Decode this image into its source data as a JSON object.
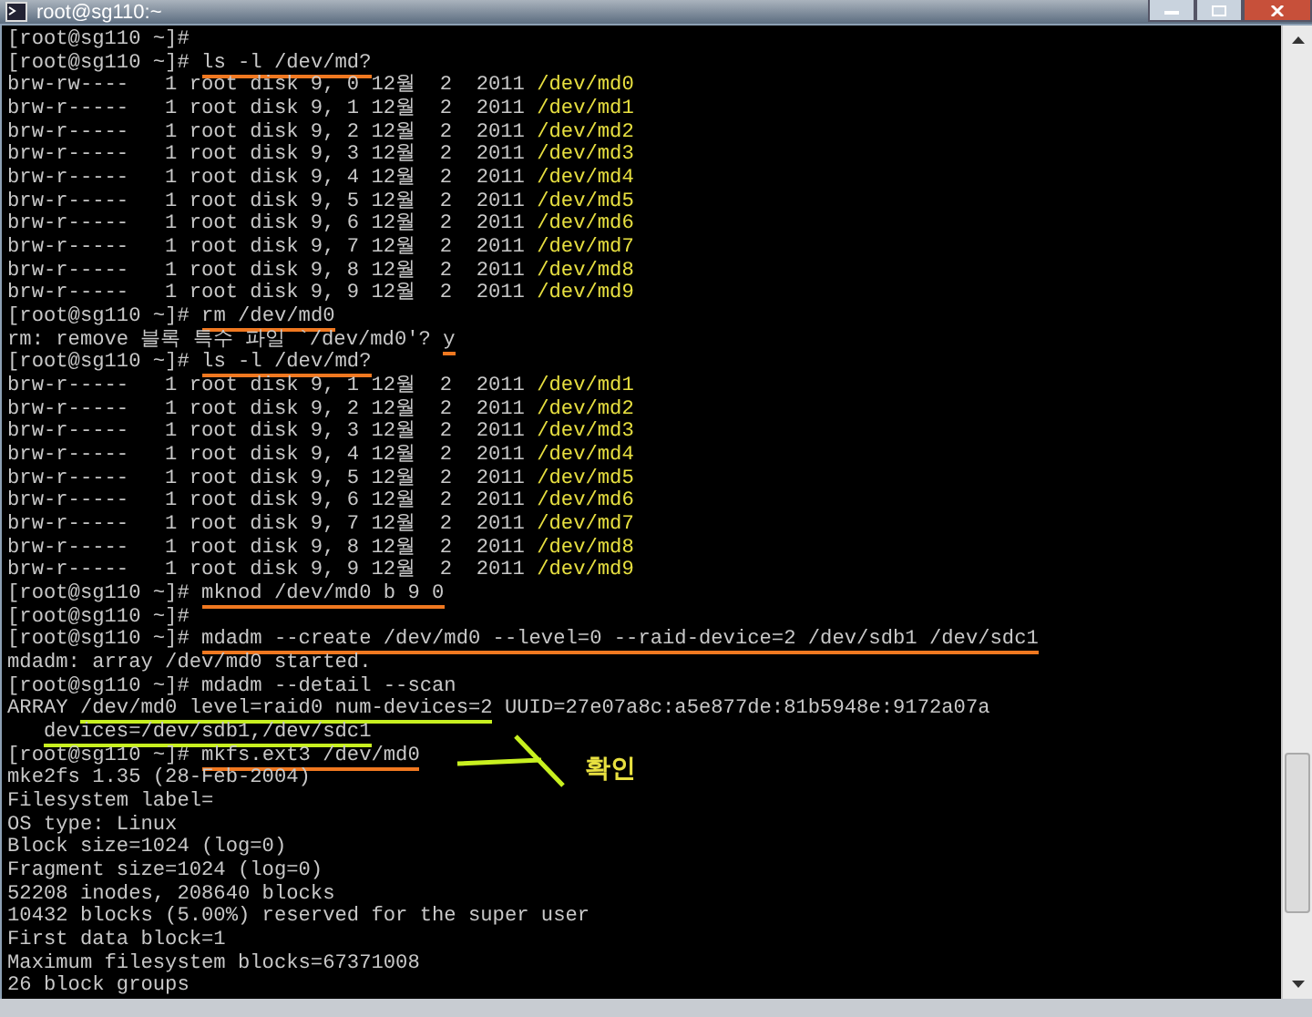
{
  "window": {
    "title": "root@sg110:~"
  },
  "terminal": {
    "lines": [
      {
        "segments": [
          {
            "text": "[root@sg110 ~]#",
            "kind": "text"
          }
        ]
      },
      {
        "segments": [
          {
            "text": "[root@sg110 ~]# ",
            "kind": "text"
          },
          {
            "text": "ls -l /dev/md?",
            "kind": "command"
          }
        ]
      },
      {
        "segments": [
          {
            "text": "brw-rw----   1 root disk 9, 0 12월  2  2011 ",
            "kind": "text"
          },
          {
            "text": "/dev/md0",
            "kind": "path"
          }
        ]
      },
      {
        "segments": [
          {
            "text": "brw-r-----   1 root disk 9, 1 12월  2  2011 ",
            "kind": "text"
          },
          {
            "text": "/dev/md1",
            "kind": "path"
          }
        ]
      },
      {
        "segments": [
          {
            "text": "brw-r-----   1 root disk 9, 2 12월  2  2011 ",
            "kind": "text"
          },
          {
            "text": "/dev/md2",
            "kind": "path"
          }
        ]
      },
      {
        "segments": [
          {
            "text": "brw-r-----   1 root disk 9, 3 12월  2  2011 ",
            "kind": "text"
          },
          {
            "text": "/dev/md3",
            "kind": "path"
          }
        ]
      },
      {
        "segments": [
          {
            "text": "brw-r-----   1 root disk 9, 4 12월  2  2011 ",
            "kind": "text"
          },
          {
            "text": "/dev/md4",
            "kind": "path"
          }
        ]
      },
      {
        "segments": [
          {
            "text": "brw-r-----   1 root disk 9, 5 12월  2  2011 ",
            "kind": "text"
          },
          {
            "text": "/dev/md5",
            "kind": "path"
          }
        ]
      },
      {
        "segments": [
          {
            "text": "brw-r-----   1 root disk 9, 6 12월  2  2011 ",
            "kind": "text"
          },
          {
            "text": "/dev/md6",
            "kind": "path"
          }
        ]
      },
      {
        "segments": [
          {
            "text": "brw-r-----   1 root disk 9, 7 12월  2  2011 ",
            "kind": "text"
          },
          {
            "text": "/dev/md7",
            "kind": "path"
          }
        ]
      },
      {
        "segments": [
          {
            "text": "brw-r-----   1 root disk 9, 8 12월  2  2011 ",
            "kind": "text"
          },
          {
            "text": "/dev/md8",
            "kind": "path"
          }
        ]
      },
      {
        "segments": [
          {
            "text": "brw-r-----   1 root disk 9, 9 12월  2  2011 ",
            "kind": "text"
          },
          {
            "text": "/dev/md9",
            "kind": "path"
          }
        ]
      },
      {
        "segments": [
          {
            "text": "[root@sg110 ~]# ",
            "kind": "text"
          },
          {
            "text": "rm /dev/md0",
            "kind": "command"
          }
        ]
      },
      {
        "segments": [
          {
            "text": "rm: remove 블록 특수 파일 `/dev/md0'? ",
            "kind": "text"
          },
          {
            "text": "y",
            "kind": "command"
          }
        ]
      },
      {
        "segments": [
          {
            "text": "[root@sg110 ~]# ",
            "kind": "text"
          },
          {
            "text": "ls -l /dev/md?",
            "kind": "command"
          }
        ]
      },
      {
        "segments": [
          {
            "text": "brw-r-----   1 root disk 9, 1 12월  2  2011 ",
            "kind": "text"
          },
          {
            "text": "/dev/md1",
            "kind": "path"
          }
        ]
      },
      {
        "segments": [
          {
            "text": "brw-r-----   1 root disk 9, 2 12월  2  2011 ",
            "kind": "text"
          },
          {
            "text": "/dev/md2",
            "kind": "path"
          }
        ]
      },
      {
        "segments": [
          {
            "text": "brw-r-----   1 root disk 9, 3 12월  2  2011 ",
            "kind": "text"
          },
          {
            "text": "/dev/md3",
            "kind": "path"
          }
        ]
      },
      {
        "segments": [
          {
            "text": "brw-r-----   1 root disk 9, 4 12월  2  2011 ",
            "kind": "text"
          },
          {
            "text": "/dev/md4",
            "kind": "path"
          }
        ]
      },
      {
        "segments": [
          {
            "text": "brw-r-----   1 root disk 9, 5 12월  2  2011 ",
            "kind": "text"
          },
          {
            "text": "/dev/md5",
            "kind": "path"
          }
        ]
      },
      {
        "segments": [
          {
            "text": "brw-r-----   1 root disk 9, 6 12월  2  2011 ",
            "kind": "text"
          },
          {
            "text": "/dev/md6",
            "kind": "path"
          }
        ]
      },
      {
        "segments": [
          {
            "text": "brw-r-----   1 root disk 9, 7 12월  2  2011 ",
            "kind": "text"
          },
          {
            "text": "/dev/md7",
            "kind": "path"
          }
        ]
      },
      {
        "segments": [
          {
            "text": "brw-r-----   1 root disk 9, 8 12월  2  2011 ",
            "kind": "text"
          },
          {
            "text": "/dev/md8",
            "kind": "path"
          }
        ]
      },
      {
        "segments": [
          {
            "text": "brw-r-----   1 root disk 9, 9 12월  2  2011 ",
            "kind": "text"
          },
          {
            "text": "/dev/md9",
            "kind": "path"
          }
        ]
      },
      {
        "segments": [
          {
            "text": "[root@sg110 ~]# ",
            "kind": "text"
          },
          {
            "text": "mknod /dev/md0 b 9 0",
            "kind": "command"
          }
        ]
      },
      {
        "segments": [
          {
            "text": "[root@sg110 ~]#",
            "kind": "text"
          }
        ]
      },
      {
        "segments": [
          {
            "text": "[root@sg110 ~]# ",
            "kind": "text"
          },
          {
            "text": "mdadm --create /dev/md0 --level=0 --raid-device=2 /dev/sdb1 /dev/sdc1",
            "kind": "command"
          }
        ]
      },
      {
        "segments": [
          {
            "text": "mdadm: array /dev/md0 started.",
            "kind": "text"
          }
        ]
      },
      {
        "segments": [
          {
            "text": "[root@sg110 ~]# mdadm --detail --scan",
            "kind": "text"
          }
        ]
      },
      {
        "segments": [
          {
            "text": "ARRAY ",
            "kind": "text"
          },
          {
            "text": "/dev/md0 level=raid0 num-devices=2",
            "kind": "result"
          },
          {
            "text": " UUID=27e07a8c:a5e877de:81b5948e:9172a07a",
            "kind": "text"
          }
        ]
      },
      {
        "segments": [
          {
            "text": "   devices=/dev/sdb1,/dev/sdc1",
            "kind": "result"
          }
        ]
      },
      {
        "segments": [
          {
            "text": "[root@sg110 ~]# ",
            "kind": "text"
          },
          {
            "text": "mkfs.ext3 /dev/md0",
            "kind": "command"
          }
        ]
      },
      {
        "segments": [
          {
            "text": "mke2fs 1.35 (28-Feb-2004)",
            "kind": "text"
          }
        ]
      },
      {
        "segments": [
          {
            "text": "Filesystem label=",
            "kind": "text"
          }
        ]
      },
      {
        "segments": [
          {
            "text": "OS type: Linux",
            "kind": "text"
          }
        ]
      },
      {
        "segments": [
          {
            "text": "Block size=1024 (log=0)",
            "kind": "text"
          }
        ]
      },
      {
        "segments": [
          {
            "text": "Fragment size=1024 (log=0)",
            "kind": "text"
          }
        ]
      },
      {
        "segments": [
          {
            "text": "52208 inodes, 208640 blocks",
            "kind": "text"
          }
        ]
      },
      {
        "segments": [
          {
            "text": "10432 blocks (5.00%) reserved for the super user",
            "kind": "text"
          }
        ]
      },
      {
        "segments": [
          {
            "text": "First data block=1",
            "kind": "text"
          }
        ]
      },
      {
        "segments": [
          {
            "text": "Maximum filesystem blocks=67371008",
            "kind": "text"
          }
        ]
      },
      {
        "segments": [
          {
            "text": "26 block groups",
            "kind": "text"
          }
        ]
      }
    ]
  },
  "callout": {
    "label": "확인"
  }
}
